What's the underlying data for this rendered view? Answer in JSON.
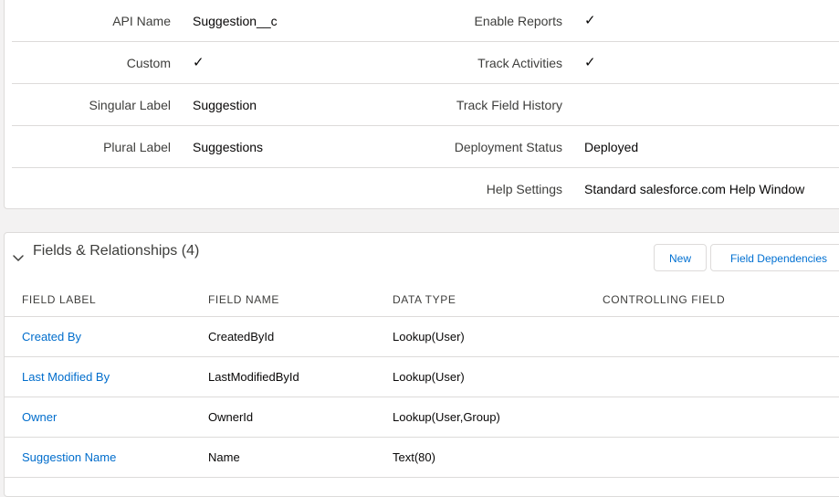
{
  "details": {
    "rows": [
      {
        "left_label": "API Name",
        "left_value": "Suggestion__c",
        "right_label": "Enable Reports",
        "right_value": "✓"
      },
      {
        "left_label": "Custom",
        "left_value": "✓",
        "right_label": "Track Activities",
        "right_value": "✓"
      },
      {
        "left_label": "Singular Label",
        "left_value": "Suggestion",
        "right_label": "Track Field History",
        "right_value": ""
      },
      {
        "left_label": "Plural Label",
        "left_value": "Suggestions",
        "right_label": "Deployment Status",
        "right_value": "Deployed"
      },
      {
        "left_label": "",
        "left_value": "",
        "right_label": "Help Settings",
        "right_value": "Standard salesforce.com Help Window"
      }
    ]
  },
  "fields_section": {
    "title": "Fields & Relationships (4)",
    "new_button": "New",
    "field_dependencies_button": "Field Dependencies",
    "columns": [
      "FIELD LABEL",
      "FIELD NAME",
      "DATA TYPE",
      "CONTROLLING FIELD"
    ],
    "rows": [
      {
        "label": "Created By",
        "name": "CreatedById",
        "type": "Lookup(User)",
        "controlling": ""
      },
      {
        "label": "Last Modified By",
        "name": "LastModifiedById",
        "type": "Lookup(User)",
        "controlling": ""
      },
      {
        "label": "Owner",
        "name": "OwnerId",
        "type": "Lookup(User,Group)",
        "controlling": ""
      },
      {
        "label": "Suggestion Name",
        "name": "Name",
        "type": "Text(80)",
        "controlling": ""
      }
    ]
  },
  "colors": {
    "link": "#006dcc",
    "border": "#dddbda",
    "background": "#f3f2f2"
  }
}
